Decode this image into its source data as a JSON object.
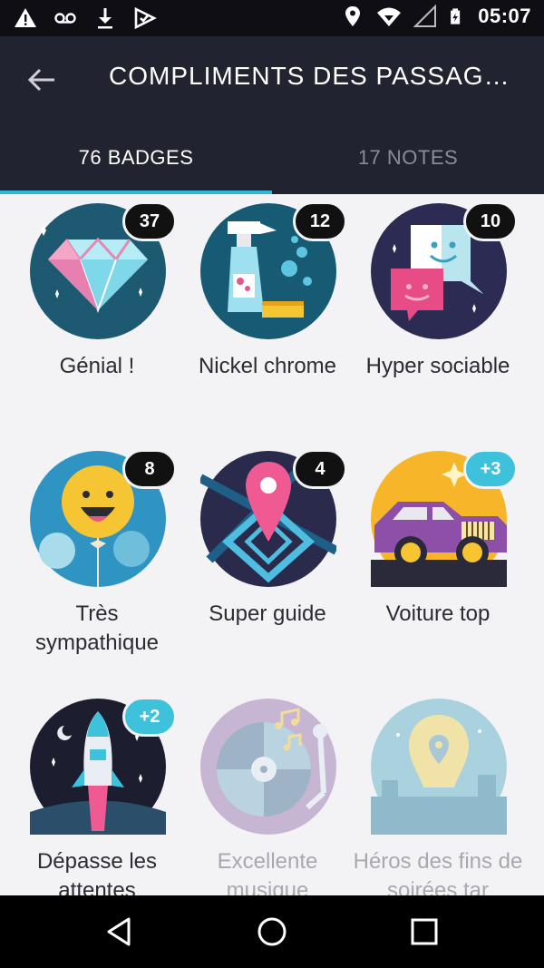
{
  "status_bar": {
    "time": "05:07",
    "icons_left": [
      "warning-icon",
      "voicemail-icon",
      "download-icon",
      "app-check-icon"
    ],
    "icons_right": [
      "location-icon",
      "wifi-icon",
      "signal-icon",
      "battery-icon"
    ]
  },
  "app_bar": {
    "back_icon": "arrow-left-icon",
    "title": "COMPLIMENTS DES PASSAG…"
  },
  "tabs": [
    {
      "label": "76 BADGES",
      "active": true
    },
    {
      "label": "17 NOTES",
      "active": false
    }
  ],
  "colors": {
    "accent": "#2fb9d6",
    "header": "#222330",
    "count_dark": "#111111",
    "count_new": "#3ec2dc"
  },
  "badges": [
    {
      "label": "Génial !",
      "count": "37",
      "count_style": "dark",
      "icon": "diamond-icon"
    },
    {
      "label": "Nickel chrome",
      "count": "12",
      "count_style": "dark",
      "icon": "cleaning-spray-icon"
    },
    {
      "label": "Hyper sociable",
      "count": "10",
      "count_style": "dark",
      "icon": "chat-bubbles-icon"
    },
    {
      "label": "Très sympathique",
      "count": "8",
      "count_style": "dark",
      "icon": "smiley-balloon-icon"
    },
    {
      "label": "Super guide",
      "count": "4",
      "count_style": "dark",
      "icon": "map-pin-icon"
    },
    {
      "label": "Voiture top",
      "count": "+3",
      "count_style": "blue",
      "icon": "car-icon"
    },
    {
      "label": "Dépasse les attentes",
      "count": "+2",
      "count_style": "blue",
      "icon": "rocket-icon"
    },
    {
      "label": "Excellente musique",
      "count": "",
      "count_style": "none",
      "icon": "record-player-icon"
    },
    {
      "label": "Héros des fins de soirées tar",
      "count": "",
      "count_style": "none",
      "icon": "night-pin-icon"
    }
  ],
  "nav_bar": {
    "buttons": [
      "back-triangle-icon",
      "home-circle-icon",
      "recents-square-icon"
    ]
  }
}
